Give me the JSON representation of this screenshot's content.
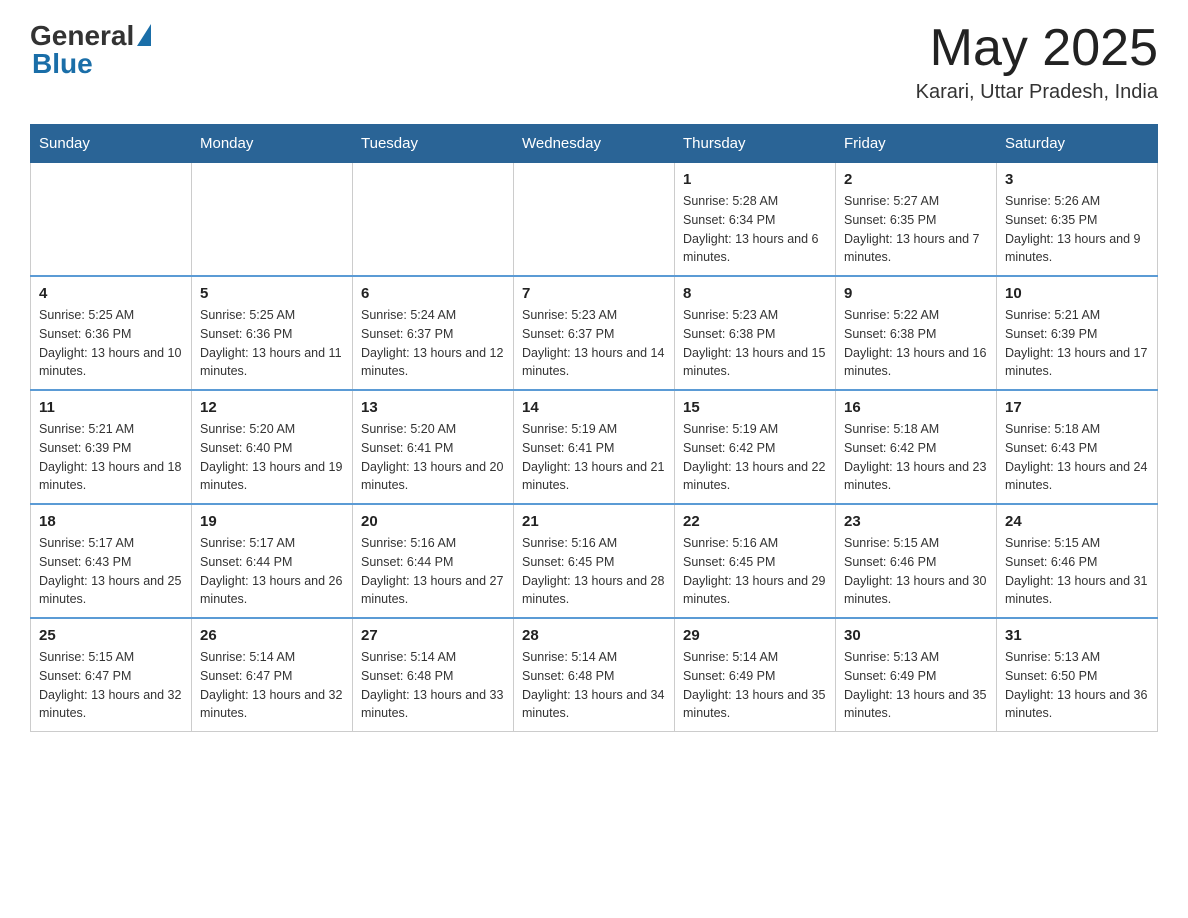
{
  "logo": {
    "general": "General",
    "blue": "Blue"
  },
  "title": {
    "month_year": "May 2025",
    "location": "Karari, Uttar Pradesh, India"
  },
  "days_of_week": [
    "Sunday",
    "Monday",
    "Tuesday",
    "Wednesday",
    "Thursday",
    "Friday",
    "Saturday"
  ],
  "weeks": [
    [
      {
        "day": "",
        "info": ""
      },
      {
        "day": "",
        "info": ""
      },
      {
        "day": "",
        "info": ""
      },
      {
        "day": "",
        "info": ""
      },
      {
        "day": "1",
        "info": "Sunrise: 5:28 AM\nSunset: 6:34 PM\nDaylight: 13 hours and 6 minutes."
      },
      {
        "day": "2",
        "info": "Sunrise: 5:27 AM\nSunset: 6:35 PM\nDaylight: 13 hours and 7 minutes."
      },
      {
        "day": "3",
        "info": "Sunrise: 5:26 AM\nSunset: 6:35 PM\nDaylight: 13 hours and 9 minutes."
      }
    ],
    [
      {
        "day": "4",
        "info": "Sunrise: 5:25 AM\nSunset: 6:36 PM\nDaylight: 13 hours and 10 minutes."
      },
      {
        "day": "5",
        "info": "Sunrise: 5:25 AM\nSunset: 6:36 PM\nDaylight: 13 hours and 11 minutes."
      },
      {
        "day": "6",
        "info": "Sunrise: 5:24 AM\nSunset: 6:37 PM\nDaylight: 13 hours and 12 minutes."
      },
      {
        "day": "7",
        "info": "Sunrise: 5:23 AM\nSunset: 6:37 PM\nDaylight: 13 hours and 14 minutes."
      },
      {
        "day": "8",
        "info": "Sunrise: 5:23 AM\nSunset: 6:38 PM\nDaylight: 13 hours and 15 minutes."
      },
      {
        "day": "9",
        "info": "Sunrise: 5:22 AM\nSunset: 6:38 PM\nDaylight: 13 hours and 16 minutes."
      },
      {
        "day": "10",
        "info": "Sunrise: 5:21 AM\nSunset: 6:39 PM\nDaylight: 13 hours and 17 minutes."
      }
    ],
    [
      {
        "day": "11",
        "info": "Sunrise: 5:21 AM\nSunset: 6:39 PM\nDaylight: 13 hours and 18 minutes."
      },
      {
        "day": "12",
        "info": "Sunrise: 5:20 AM\nSunset: 6:40 PM\nDaylight: 13 hours and 19 minutes."
      },
      {
        "day": "13",
        "info": "Sunrise: 5:20 AM\nSunset: 6:41 PM\nDaylight: 13 hours and 20 minutes."
      },
      {
        "day": "14",
        "info": "Sunrise: 5:19 AM\nSunset: 6:41 PM\nDaylight: 13 hours and 21 minutes."
      },
      {
        "day": "15",
        "info": "Sunrise: 5:19 AM\nSunset: 6:42 PM\nDaylight: 13 hours and 22 minutes."
      },
      {
        "day": "16",
        "info": "Sunrise: 5:18 AM\nSunset: 6:42 PM\nDaylight: 13 hours and 23 minutes."
      },
      {
        "day": "17",
        "info": "Sunrise: 5:18 AM\nSunset: 6:43 PM\nDaylight: 13 hours and 24 minutes."
      }
    ],
    [
      {
        "day": "18",
        "info": "Sunrise: 5:17 AM\nSunset: 6:43 PM\nDaylight: 13 hours and 25 minutes."
      },
      {
        "day": "19",
        "info": "Sunrise: 5:17 AM\nSunset: 6:44 PM\nDaylight: 13 hours and 26 minutes."
      },
      {
        "day": "20",
        "info": "Sunrise: 5:16 AM\nSunset: 6:44 PM\nDaylight: 13 hours and 27 minutes."
      },
      {
        "day": "21",
        "info": "Sunrise: 5:16 AM\nSunset: 6:45 PM\nDaylight: 13 hours and 28 minutes."
      },
      {
        "day": "22",
        "info": "Sunrise: 5:16 AM\nSunset: 6:45 PM\nDaylight: 13 hours and 29 minutes."
      },
      {
        "day": "23",
        "info": "Sunrise: 5:15 AM\nSunset: 6:46 PM\nDaylight: 13 hours and 30 minutes."
      },
      {
        "day": "24",
        "info": "Sunrise: 5:15 AM\nSunset: 6:46 PM\nDaylight: 13 hours and 31 minutes."
      }
    ],
    [
      {
        "day": "25",
        "info": "Sunrise: 5:15 AM\nSunset: 6:47 PM\nDaylight: 13 hours and 32 minutes."
      },
      {
        "day": "26",
        "info": "Sunrise: 5:14 AM\nSunset: 6:47 PM\nDaylight: 13 hours and 32 minutes."
      },
      {
        "day": "27",
        "info": "Sunrise: 5:14 AM\nSunset: 6:48 PM\nDaylight: 13 hours and 33 minutes."
      },
      {
        "day": "28",
        "info": "Sunrise: 5:14 AM\nSunset: 6:48 PM\nDaylight: 13 hours and 34 minutes."
      },
      {
        "day": "29",
        "info": "Sunrise: 5:14 AM\nSunset: 6:49 PM\nDaylight: 13 hours and 35 minutes."
      },
      {
        "day": "30",
        "info": "Sunrise: 5:13 AM\nSunset: 6:49 PM\nDaylight: 13 hours and 35 minutes."
      },
      {
        "day": "31",
        "info": "Sunrise: 5:13 AM\nSunset: 6:50 PM\nDaylight: 13 hours and 36 minutes."
      }
    ]
  ]
}
